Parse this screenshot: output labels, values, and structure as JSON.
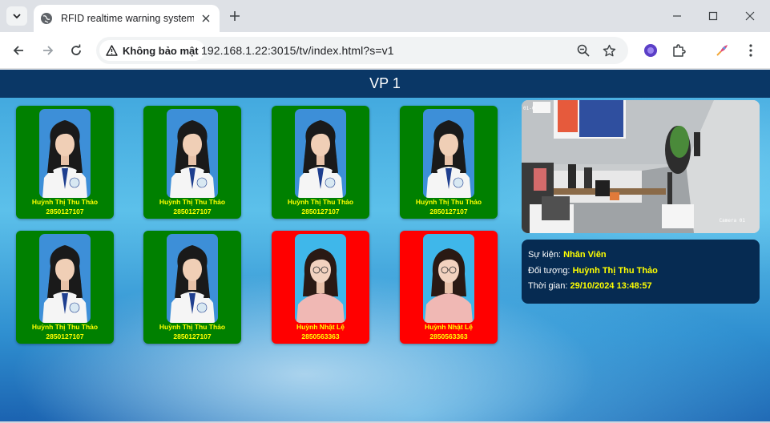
{
  "browser": {
    "tab_title": "RFID realtime warning system v",
    "security_label": "Không bảo mật",
    "url": "192.168.1.22:3015/tv/index.html?s=v1"
  },
  "page": {
    "title": "VP 1"
  },
  "cards": [
    {
      "name": "Huỳnh Thị Thu Thảo",
      "id": "2850127107",
      "status": "green"
    },
    {
      "name": "Huỳnh Thị Thu Thảo",
      "id": "2850127107",
      "status": "green"
    },
    {
      "name": "Huỳnh Thị Thu Thảo",
      "id": "2850127107",
      "status": "green"
    },
    {
      "name": "Huỳnh Thị Thu Thảo",
      "id": "2850127107",
      "status": "green"
    },
    {
      "name": "Huỳnh Thị Thu Thảo",
      "id": "2850127107",
      "status": "green"
    },
    {
      "name": "Huỳnh Thị Thu Thảo",
      "id": "2850127107",
      "status": "green"
    },
    {
      "name": "Huỳnh Nhật Lệ",
      "id": "2850563363",
      "status": "red"
    },
    {
      "name": "Huỳnh Nhật Lệ",
      "id": "2850563363",
      "status": "red"
    }
  ],
  "camera": {
    "label": "Camera 01",
    "timestamp": "01-0"
  },
  "event": {
    "event_label": "Sự kiện:",
    "event_value": "Nhân Viên",
    "subject_label": "Đối tượng:",
    "subject_value": "Huỳnh Thị Thu Thảo",
    "time_label": "Thời gian:",
    "time_value": "29/10/2024 13:48:57"
  },
  "colors": {
    "header_bg": "#0a3766",
    "card_ok": "#008000",
    "card_alert": "#ff0000",
    "highlight_text": "#ffff00",
    "event_bg": "#062b52"
  }
}
